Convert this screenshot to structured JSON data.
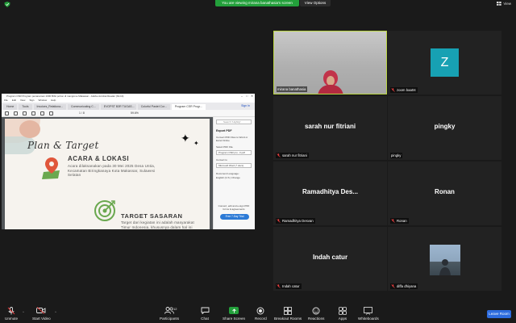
{
  "top": {
    "banner": "You are viewing mirana banathasia's screen",
    "view_options": "View Options",
    "view": "View"
  },
  "shared_window": {
    "title": "Program CSR Program penanaman 1000 Bibit pohon di mangrove Makassar - Adobe Acrobat Reader (64-bit)",
    "menu": [
      "File",
      "Edit",
      "View",
      "Sign",
      "Window",
      "Help"
    ],
    "tabs": [
      "Home",
      "Tools",
      "Invoices_Relationa...",
      "Communicating C...",
      "EVOPST B3R TUGAS...",
      "Colorful Pastel Cor...",
      "Program CSR Progr..."
    ],
    "sign_in": "Sign In",
    "page_indicator": "1 / 8",
    "zoom": "59.6%",
    "slide": {
      "title": "Plan & Target",
      "acara_heading": "ACARA & LOKASI",
      "acara_text": "Acara dilaksanakan pada 30 Mei 2025 Desa Untia, Kecamatan Biringkanaya Kota Makassar, Sulawesi Selatan",
      "target_heading": "TARGET SASARAN",
      "target_text": "Target dari kegiatan ini adalah masyarakat Timur Indonesia, khususnya dalam hal ini adalah masyarakat yang berada di Makassar."
    },
    "panel": {
      "search_placeholder": "Search \"Highlig\"",
      "heading": "Export PDF",
      "desc": "Convert PDF Files to Word or Excel Online",
      "select_label": "Select PDF File",
      "file": "Program CSR pro...F.pdf",
      "convert_label": "Convert to",
      "convert_value": "Microsoft Word (*.docx)",
      "lang_label": "Document Language:",
      "lang_value": "English (U.S.) Change",
      "promo": "Convert, edit and e-sign PDF forms & agreements",
      "trial_button": "Free 7-Day Trial"
    }
  },
  "tiles": [
    {
      "name": "mirana banathasia",
      "type": "video"
    },
    {
      "name": "zoom baa04",
      "type": "avatar",
      "initial": "Z"
    },
    {
      "name": "sarah nur fitriani",
      "display": "sarah nur fitriani"
    },
    {
      "name": "pingky",
      "display": "pingky"
    },
    {
      "name": "Ramadhitya Desvan",
      "display": "Ramadhitya  Des..."
    },
    {
      "name": "Ronan",
      "display": "Ronan"
    },
    {
      "name": "Indah catur",
      "display": "Indah catur"
    },
    {
      "name": "diffa dhiyana",
      "type": "photo"
    }
  ],
  "toolbar": {
    "unmute": "Unmute",
    "start_video": "Start Video",
    "participants": "Participants",
    "participants_count": "12",
    "chat": "Chat",
    "share_screen": "Share Screen",
    "record": "Record",
    "breakout": "Breakout Rooms",
    "reactions": "Reactions",
    "apps": "Apps",
    "whiteboards": "Whiteboards",
    "leave": "Leave Room"
  },
  "colors": {
    "banner_green": "#23a03b",
    "active_speaker_border": "#b9d442",
    "avatar_teal": "#17a1b3",
    "leave_blue": "#2d6cdf"
  }
}
